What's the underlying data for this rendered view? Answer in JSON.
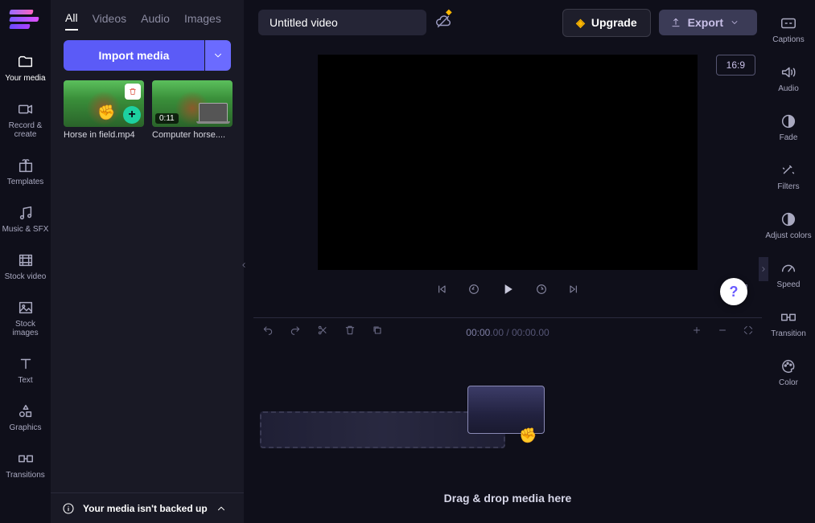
{
  "header": {
    "title": "Untitled video",
    "upgrade_label": "Upgrade",
    "export_label": "Export",
    "aspect_ratio": "16:9"
  },
  "left_sidebar": {
    "items": [
      {
        "label": "Your media"
      },
      {
        "label": "Record & create"
      },
      {
        "label": "Templates"
      },
      {
        "label": "Music & SFX"
      },
      {
        "label": "Stock video"
      },
      {
        "label": "Stock images"
      },
      {
        "label": "Text"
      },
      {
        "label": "Graphics"
      },
      {
        "label": "Transitions"
      }
    ]
  },
  "media_panel": {
    "tabs": {
      "all": "All",
      "videos": "Videos",
      "audio": "Audio",
      "images": "Images"
    },
    "import_label": "Import media",
    "clips": [
      {
        "name": "Horse in field.mp4"
      },
      {
        "name": "Computer horse....",
        "duration": "0:11"
      }
    ],
    "backup_notice": "Your media isn't backed up"
  },
  "timeline": {
    "current": "00:00",
    "current_frac": ".00",
    "total": "00:00",
    "total_frac": ".00",
    "drop_hint": "Drag & drop media here"
  },
  "right_sidebar": {
    "items": [
      {
        "label": "Captions"
      },
      {
        "label": "Audio"
      },
      {
        "label": "Fade"
      },
      {
        "label": "Filters"
      },
      {
        "label": "Adjust colors"
      },
      {
        "label": "Speed"
      },
      {
        "label": "Transition"
      },
      {
        "label": "Color"
      }
    ]
  }
}
